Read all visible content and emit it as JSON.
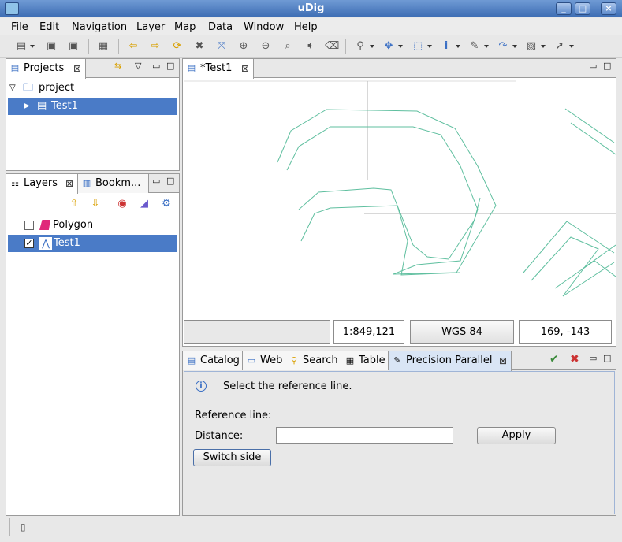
{
  "window": {
    "title": "uDig"
  },
  "menu": [
    "File",
    "Edit",
    "Navigation",
    "Layer",
    "Map",
    "Data",
    "Window",
    "Help"
  ],
  "projects_view": {
    "tab_label": "Projects",
    "tree": [
      {
        "label": "project",
        "icon": "folder-icon"
      },
      {
        "label": "Test1",
        "icon": "map-icon",
        "selected": true
      }
    ]
  },
  "layers_view": {
    "tabs": [
      "Layers",
      "Bookm..."
    ],
    "layers": [
      {
        "label": "Polygon",
        "checked": false,
        "icon": "polygon-layer-icon"
      },
      {
        "label": "Test1",
        "checked": true,
        "icon": "line-layer-icon",
        "selected": true
      }
    ]
  },
  "map_editor": {
    "tab_label": "*Test1"
  },
  "map_status": {
    "scale": "1:849,121",
    "crs": "WGS 84",
    "coordinates": "169, -143"
  },
  "bottom_tabs": [
    "Catalog",
    "Web",
    "Search",
    "Table",
    "Precision Parallel"
  ],
  "precision_parallel": {
    "info_message": "Select the reference line.",
    "reference_line_label": "Reference line:",
    "distance_label": "Distance:",
    "distance_value": "",
    "apply_label": "Apply",
    "switch_side_label": "Switch side"
  },
  "colors": {
    "selection": "#4a7bc7",
    "map_line": "#5fbf9f"
  }
}
